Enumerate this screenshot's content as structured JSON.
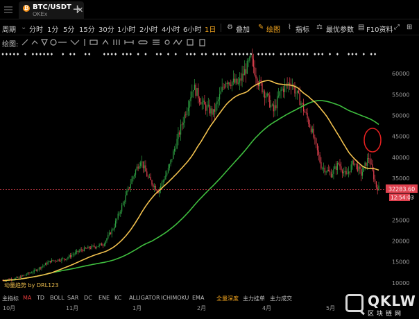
{
  "tab": {
    "title": "BTC/USDT",
    "exchange": "OKEx",
    "close_glyph": "✕",
    "add_glyph": "+"
  },
  "toolbar": {
    "period_label": "周期",
    "intervals": [
      "分时",
      "1分",
      "5分",
      "15分",
      "30分",
      "1小时",
      "2小时",
      "4小时",
      "6小时",
      "1日"
    ],
    "active_interval": "1日",
    "overlay": "叠加",
    "draw": "绘图",
    "indicators": "指标",
    "optimal_params": "最优参数",
    "f10": "F10资料"
  },
  "drawbar": {
    "label": "绘图:"
  },
  "chart_data": {
    "type": "candlestick",
    "y_ticks": [
      60000,
      55000,
      50000,
      45000,
      40000,
      35000,
      30000,
      25000,
      20000,
      15000,
      10000
    ],
    "ylim": [
      7500,
      66000
    ],
    "x_months": [
      "10月",
      "11月",
      "1月",
      "2月",
      "4月",
      "5月"
    ],
    "current_price": "32283.60",
    "countdown": "12:54:03",
    "indicator_label": "动量趋势 by DRL123",
    "colors": {
      "up": "#2ea043",
      "down": "#e0414f",
      "ma_fast": "#f2c14e",
      "ma_slow": "#3fbf3f",
      "price_line": "#e0414f",
      "highlight": "#e02020"
    }
  },
  "bottom_tabs": {
    "main_label": "主指标",
    "indicators": [
      "MA",
      "TD",
      "BOLL",
      "SAR",
      "DC",
      "ENE",
      "KC",
      "ALLIGATOR",
      "ICHIMOKU",
      "EMA"
    ],
    "active": "MA",
    "extra": [
      "全量深度",
      "主力挂单",
      "主力成交"
    ]
  },
  "watermark": {
    "brand": "QKLW",
    "subtitle": "区块链网"
  }
}
